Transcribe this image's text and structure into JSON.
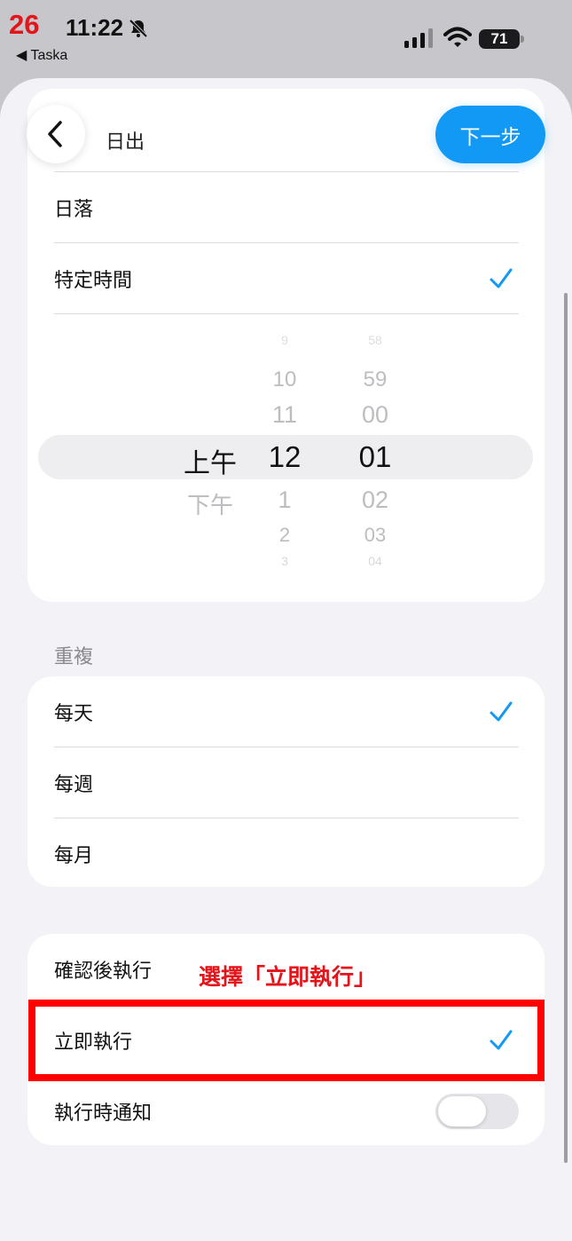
{
  "status_bar": {
    "badge_number": "26",
    "time": "11:22",
    "back_app": "◀ Taska",
    "battery": "71",
    "icons": [
      "bell-slash-icon",
      "signal-icon",
      "wifi-icon",
      "battery-icon"
    ]
  },
  "header": {
    "back_icon": "chevron-left-icon",
    "next_label": "下一步",
    "accent_color": "#1199f5"
  },
  "time_options": {
    "clipped_label": "日出",
    "items": [
      {
        "label": "日落",
        "checked": false
      },
      {
        "label": "特定時間",
        "checked": true
      }
    ]
  },
  "time_picker": {
    "period_selected": "上午",
    "period_other": "下午",
    "hours_above": [
      "9",
      "10",
      "11"
    ],
    "hour_selected": "12",
    "hours_below": [
      "1",
      "2",
      "3"
    ],
    "minutes_above": [
      "58",
      "59",
      "00"
    ],
    "minute_selected": "01",
    "minutes_below": [
      "02",
      "03",
      "04"
    ]
  },
  "repeat": {
    "title": "重複",
    "items": [
      {
        "label": "每天",
        "checked": true
      },
      {
        "label": "每週",
        "checked": false
      },
      {
        "label": "每月",
        "checked": false
      }
    ]
  },
  "execution": {
    "items": [
      {
        "label": "確認後執行",
        "checked": false
      },
      {
        "label": "立即執行",
        "checked": true
      }
    ],
    "notify_label": "執行時通知",
    "notify_enabled": false
  },
  "annotation": {
    "text": "選擇「立即執行」",
    "color": "#e4141b"
  }
}
